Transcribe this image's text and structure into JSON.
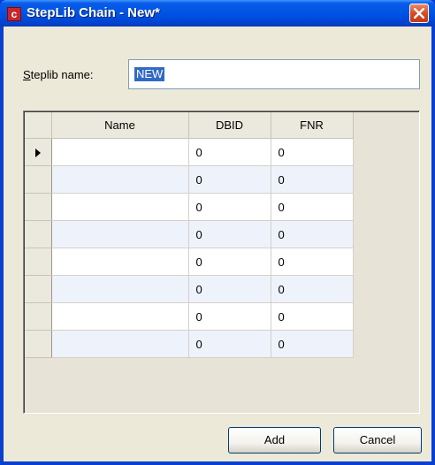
{
  "window": {
    "title": "StepLib Chain - New*",
    "app_icon_glyph": "c"
  },
  "form": {
    "steplib_label_accel": "S",
    "steplib_label_rest": "teplib name:",
    "steplib_value": "NEW"
  },
  "grid": {
    "columns": [
      "Name",
      "DBID",
      "FNR"
    ],
    "rows": [
      {
        "name": "",
        "dbid": "0",
        "fnr": "0"
      },
      {
        "name": "",
        "dbid": "0",
        "fnr": "0"
      },
      {
        "name": "",
        "dbid": "0",
        "fnr": "0"
      },
      {
        "name": "",
        "dbid": "0",
        "fnr": "0"
      },
      {
        "name": "",
        "dbid": "0",
        "fnr": "0"
      },
      {
        "name": "",
        "dbid": "0",
        "fnr": "0"
      },
      {
        "name": "",
        "dbid": "0",
        "fnr": "0"
      },
      {
        "name": "",
        "dbid": "0",
        "fnr": "0"
      }
    ]
  },
  "buttons": {
    "add": "Add",
    "cancel": "Cancel"
  },
  "icons": {
    "close": "close-icon",
    "row_pointer": "row-pointer-icon"
  },
  "colors": {
    "titlebar": "#0055e5",
    "close_button": "#d74b24",
    "selection": "#316ac5"
  }
}
